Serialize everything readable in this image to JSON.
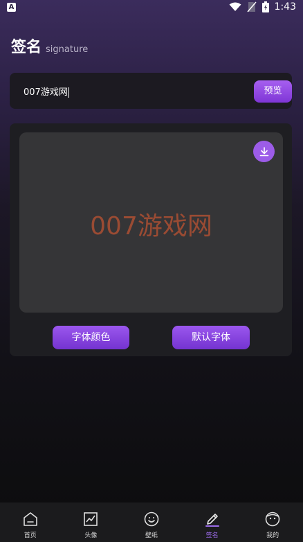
{
  "status_bar": {
    "time": "1:43",
    "notification_badge": "A"
  },
  "header": {
    "title": "签名",
    "subtitle": "signature"
  },
  "input": {
    "value": "007游戏网",
    "preview_label": "预览"
  },
  "signature": {
    "text": "007游戏网",
    "text_color": "#9a4b33"
  },
  "buttons": {
    "font_color_label": "字体颜色",
    "default_font_label": "默认字体"
  },
  "tabbar": {
    "items": [
      {
        "label": "首页",
        "icon": "home-icon"
      },
      {
        "label": "头像",
        "icon": "chart-image-icon"
      },
      {
        "label": "壁纸",
        "icon": "smiley-icon"
      },
      {
        "label": "签名",
        "icon": "pen-icon",
        "active": true
      },
      {
        "label": "我的",
        "icon": "profile-face-icon"
      }
    ]
  },
  "colors": {
    "accent": "#9b57ee",
    "active_tab": "#9b6be8"
  }
}
